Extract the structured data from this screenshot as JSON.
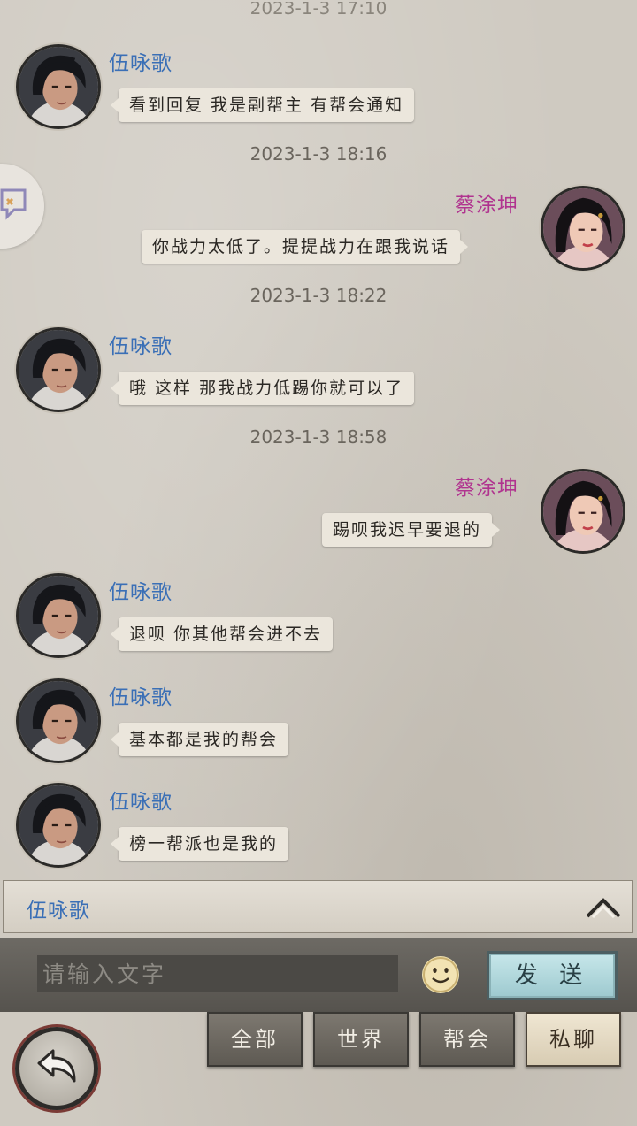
{
  "timestamps": [
    "2023-1-3 17:10",
    "2023-1-3 18:16",
    "2023-1-3 18:22",
    "2023-1-3 18:58"
  ],
  "users": {
    "male": "伍咏歌",
    "female": "蔡涂坤"
  },
  "messages": [
    {
      "text": "看到回复 我是副帮主 有帮会通知"
    },
    {
      "text": "你战力太低了。提提战力在跟我说话"
    },
    {
      "text": "哦 这样 那我战力低踢你就可以了"
    },
    {
      "text": "踢呗我迟早要退的"
    },
    {
      "text": "退呗 你其他帮会进不去"
    },
    {
      "text": "基本都是我的帮会"
    },
    {
      "text": "榜一帮派也是我的"
    }
  ],
  "target": {
    "name": "伍咏歌"
  },
  "input": {
    "placeholder": "请输入文字",
    "value": ""
  },
  "send_label": "发 送",
  "tabs": [
    {
      "label": "全部"
    },
    {
      "label": "世界"
    },
    {
      "label": "帮会"
    },
    {
      "label": "私聊",
      "active": true
    }
  ],
  "colors": {
    "male_name": "#3a6fb6",
    "female_name": "#b0338f",
    "send_button": "#a7d3d8",
    "active_tab": "#e8dcc4"
  },
  "icons": [
    "chat-bubble-icon",
    "chevron-up-icon",
    "smiley-icon",
    "back-arrow-icon"
  ]
}
